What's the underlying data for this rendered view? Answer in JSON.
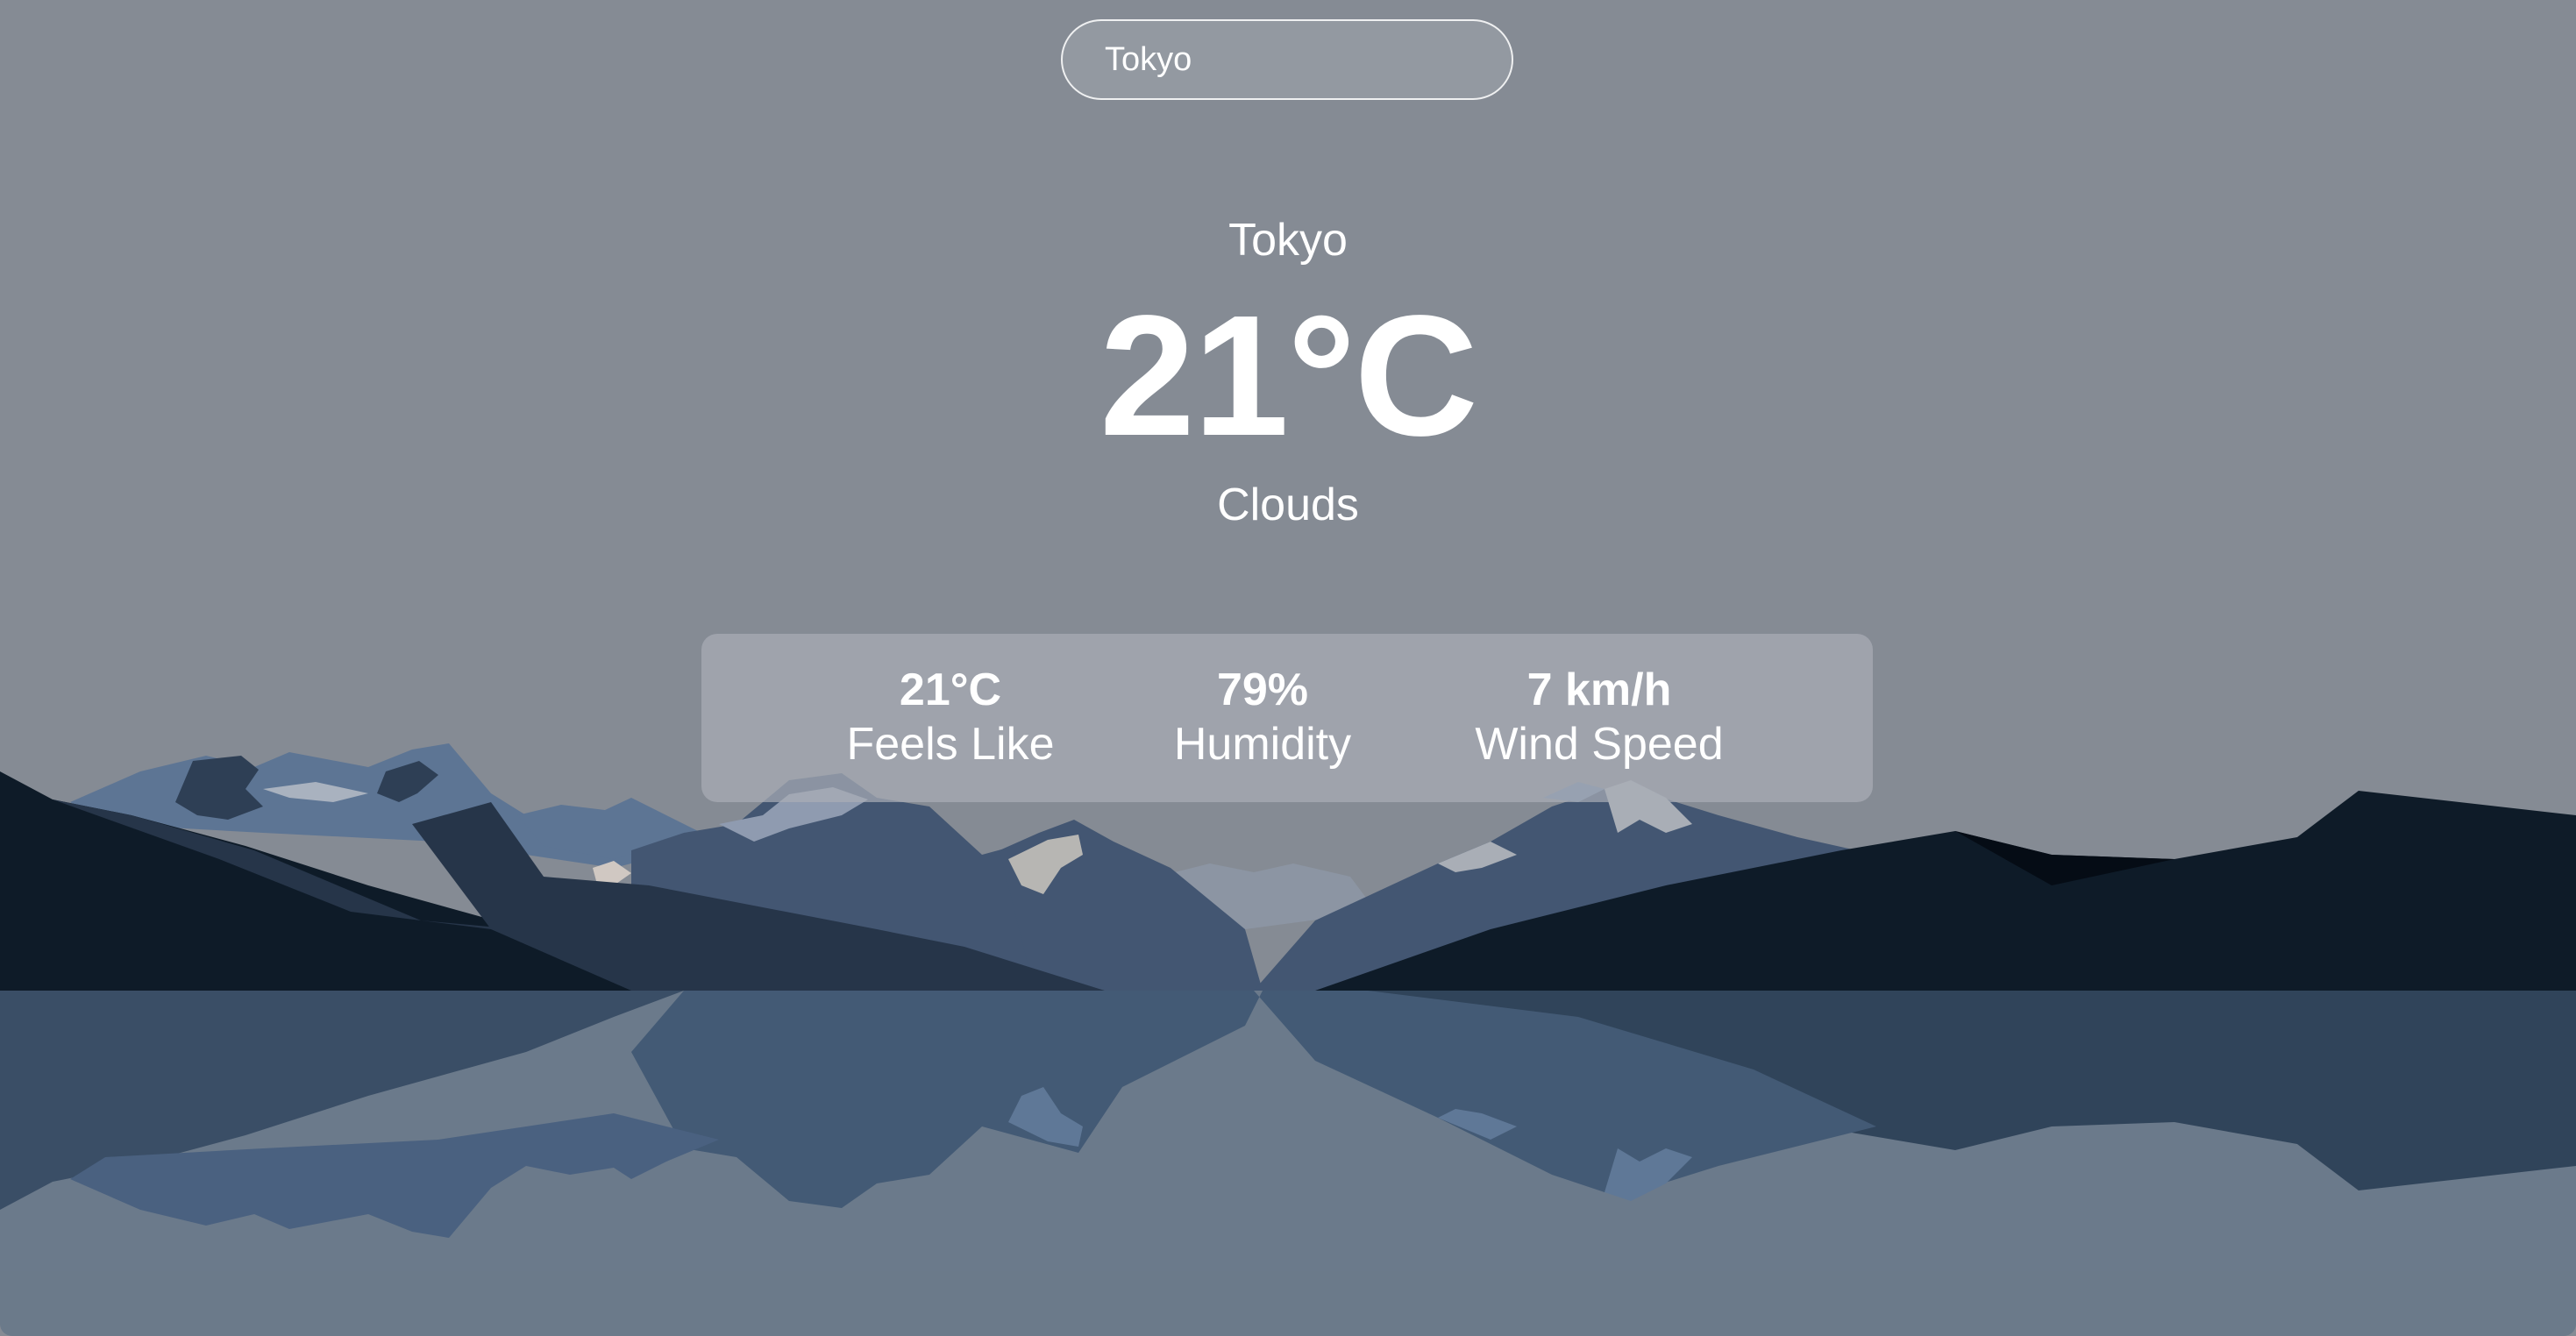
{
  "search": {
    "value": "Tokyo",
    "placeholder": ""
  },
  "weather": {
    "city": "Tokyo",
    "temperature": "21°C",
    "condition": "Clouds"
  },
  "details": [
    {
      "value": "21°C",
      "label": "Feels Like"
    },
    {
      "value": "79%",
      "label": "Humidity"
    },
    {
      "value": "7 km/h",
      "label": "Wind Speed"
    }
  ],
  "colors": {
    "sky": "#858b94",
    "panel": "#a0a4ab",
    "water": "#6b7a8b",
    "mountain_dark": "#0e1b28",
    "mountain_mid": "#435672",
    "mountain_light": "#5d7594"
  }
}
